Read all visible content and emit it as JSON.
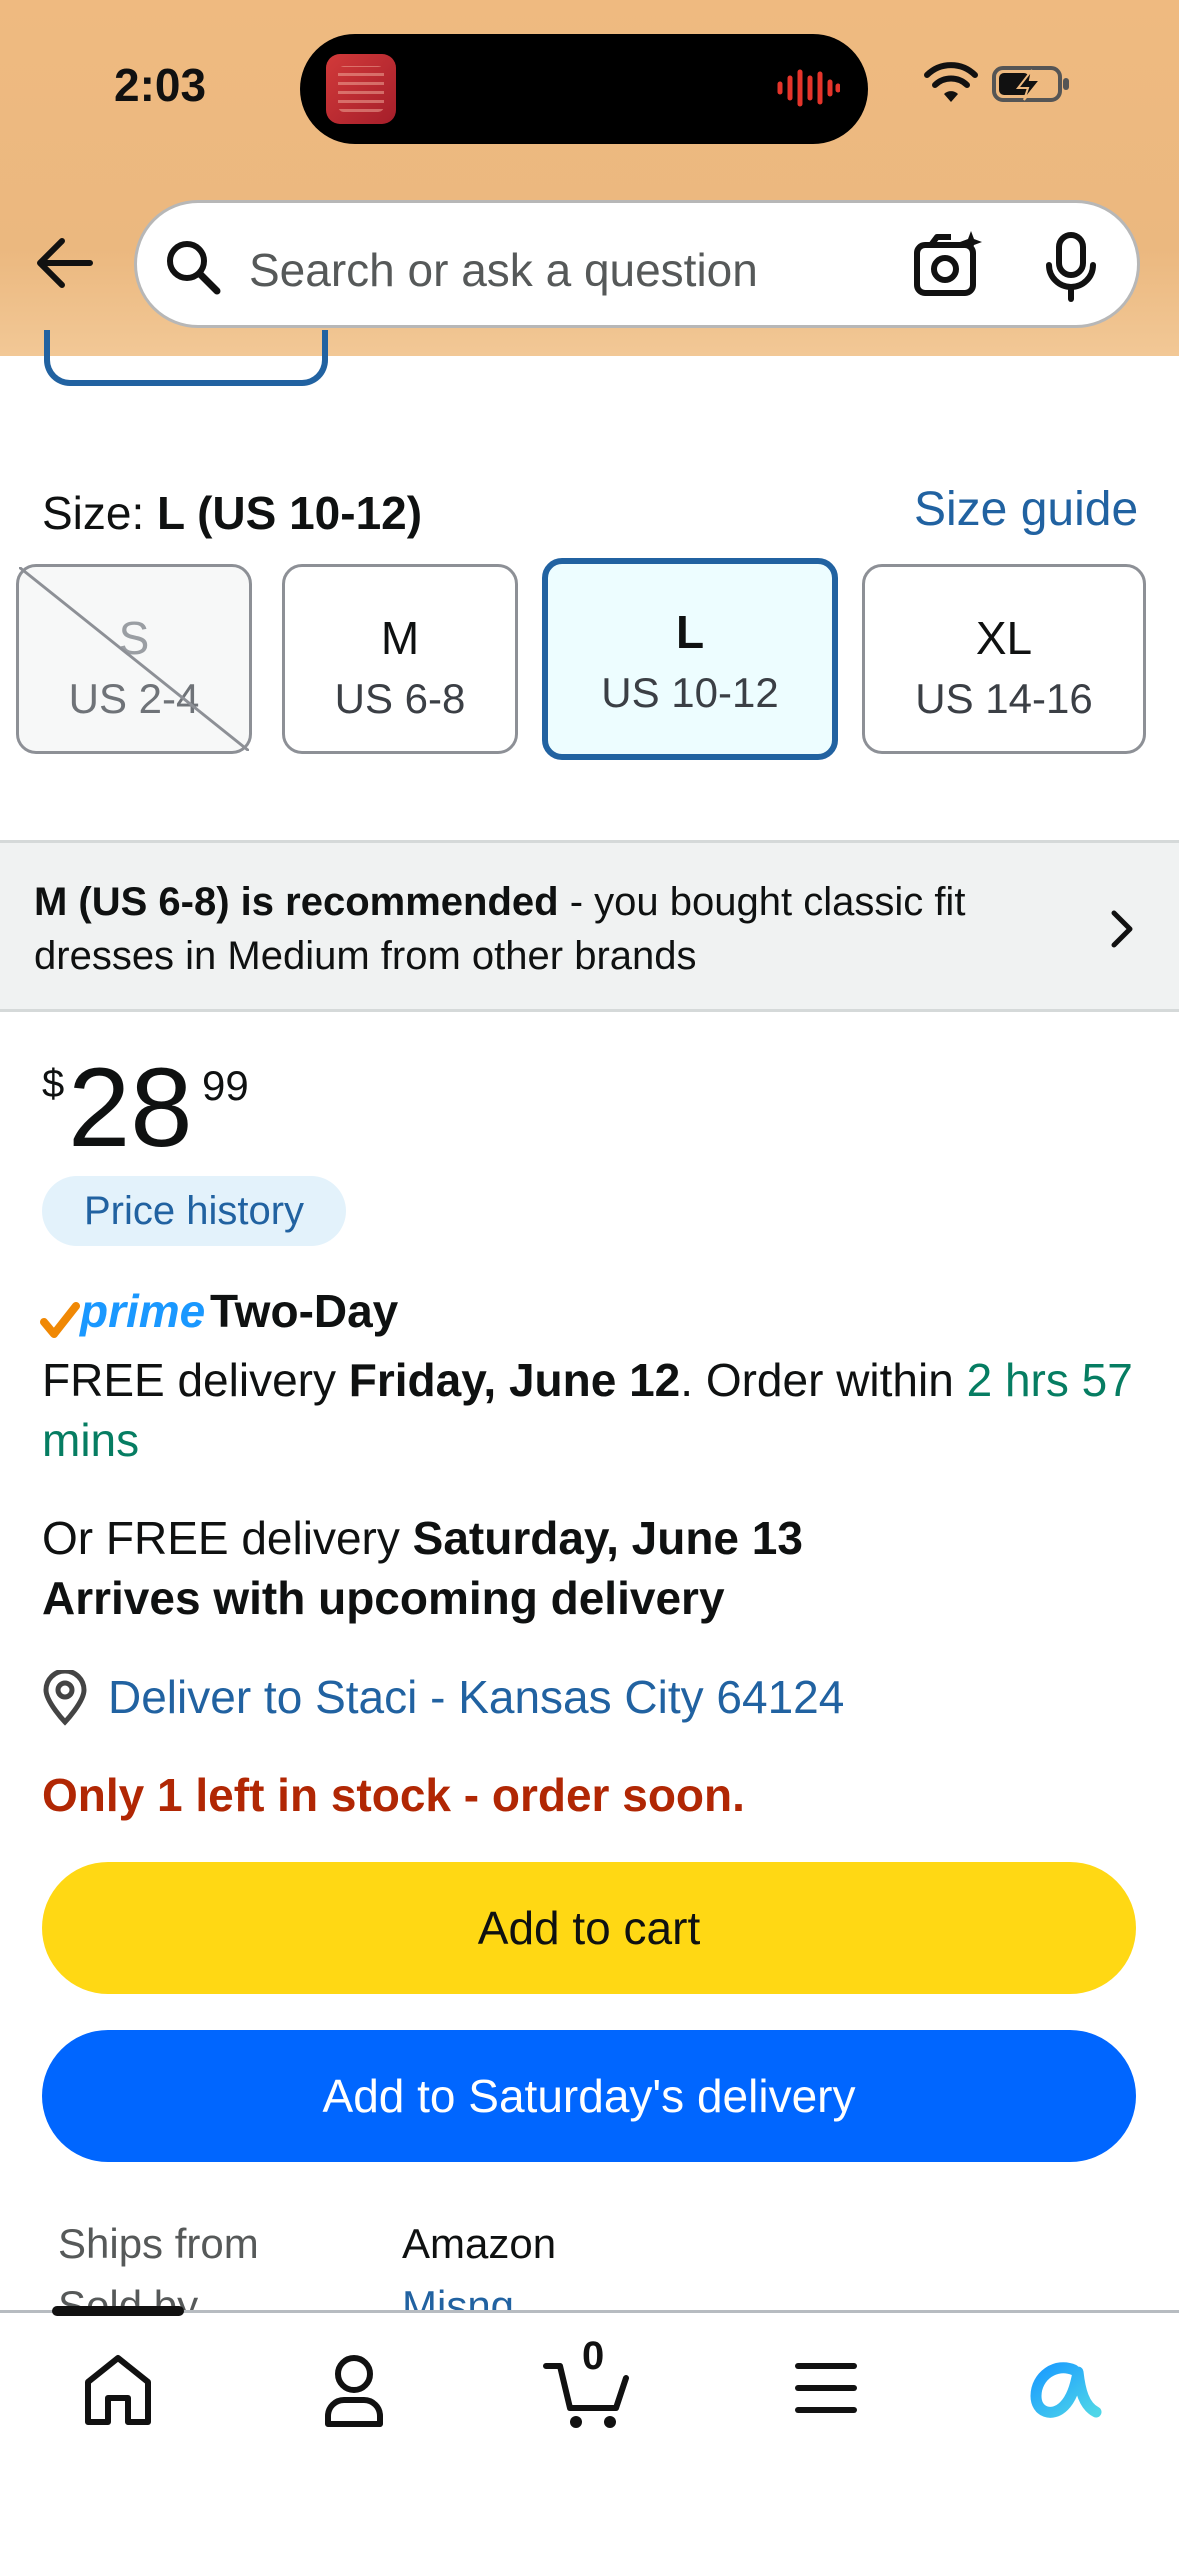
{
  "status_bar": {
    "time": "2:03"
  },
  "header": {
    "search_placeholder": "Search or ask a question"
  },
  "size": {
    "label": "Size:",
    "selected": "L (US 10-12)",
    "guide": "Size guide",
    "options": [
      {
        "name": "S",
        "us": "US 2-4",
        "state": "unavailable"
      },
      {
        "name": "M",
        "us": "US 6-8",
        "state": "available"
      },
      {
        "name": "L",
        "us": "US 10-12",
        "state": "selected"
      },
      {
        "name": "XL",
        "us": "US 14-16",
        "state": "available"
      }
    ]
  },
  "recommendation": {
    "bold": "M (US 6-8) is recommended",
    "rest": " - you bought classic fit dresses in Medium from other brands"
  },
  "price": {
    "currency": "$",
    "whole": "28",
    "fraction": "99",
    "history_label": "Price history"
  },
  "prime": {
    "word": "prime",
    "speed": "Two-Day"
  },
  "delivery": {
    "line1_a": "FREE delivery ",
    "line1_date": "Friday, June 12",
    "line1_b": ". Order within ",
    "line1_countdown": "2 hrs 57 mins",
    "line2_a": "Or FREE delivery ",
    "line2_date": "Saturday, June 13",
    "line3": "Arrives with upcoming delivery",
    "deliver_to": "Deliver to Staci - Kansas City 64124"
  },
  "stock_message": "Only 1 left in stock - order soon.",
  "buttons": {
    "add_to_cart": "Add to cart",
    "add_to_saturday": "Add to Saturday's delivery"
  },
  "seller": {
    "ships_from_label": "Ships from",
    "ships_from_value": "Amazon",
    "sold_by_label": "Sold by",
    "sold_by_value": "Misng"
  },
  "tabbar": {
    "cart_count": "0"
  },
  "colors": {
    "header_bg": "#efba80",
    "link": "#2162a1",
    "cart_button": "#ffd814",
    "secondary_button": "#0066ff",
    "stock_red": "#b12704",
    "countdown_green": "#067d62"
  }
}
